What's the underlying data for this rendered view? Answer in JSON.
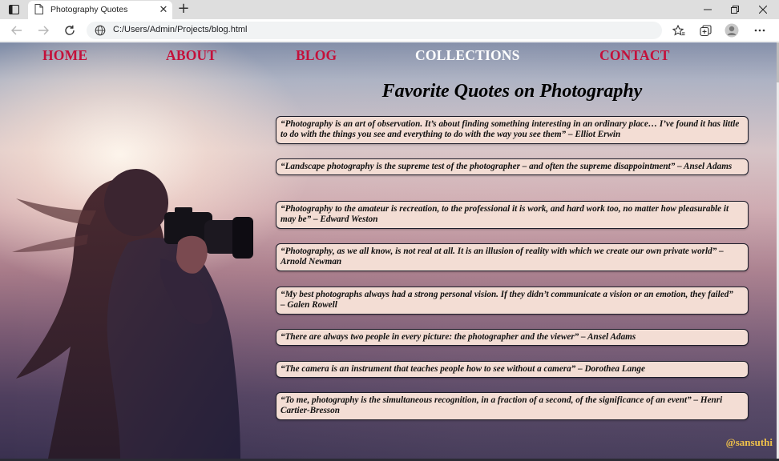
{
  "browser": {
    "tab_title": "Photography Quotes",
    "tab_close": "✕",
    "new_tab": "+",
    "url": "C:/Users/Admin/Projects/blog.html"
  },
  "nav": {
    "home": "HOME",
    "about": "ABOUT",
    "blog": "BLOG",
    "collections": "COLLECTIONS",
    "contact": "CONTACT"
  },
  "page": {
    "heading": "Favorite Quotes on Photography",
    "quotes": [
      "“Photography is an art of observation. It’s about finding something interesting in an ordinary place… I’ve found it has little to do with the things you see and everything to do with the way you see them” – Elliot Erwin",
      "“Landscape photography is the supreme test of the photographer – and often the supreme disappointment” – Ansel Adams",
      "“Photography to the amateur is recreation, to the professional it is work, and hard work too, no matter how pleasurable it may be” – Edward Weston",
      "“Photography, as we all know, is not real at all. It is an illusion of reality with which we create our own private world” – Arnold Newman",
      "“My best photographs always had a strong personal vision. If they didn’t communicate a vision or an emotion, they failed” – Galen Rowell",
      "“There are always two people in every picture: the photographer and the viewer” – Ansel Adams",
      "“The camera is an instrument that teaches people how to see without a camera” – Dorothea Lange",
      "“To me, photography is the simultaneous recognition, in a fraction of a second, of the significance of an event” – Henri Cartier-Bresson"
    ],
    "signature": "@sansuthi"
  },
  "colors": {
    "nav_link": "#c4103a",
    "nav_active": "#ffffff",
    "quote_bg": "#f3ddd4",
    "signature": "#f0c24a"
  }
}
